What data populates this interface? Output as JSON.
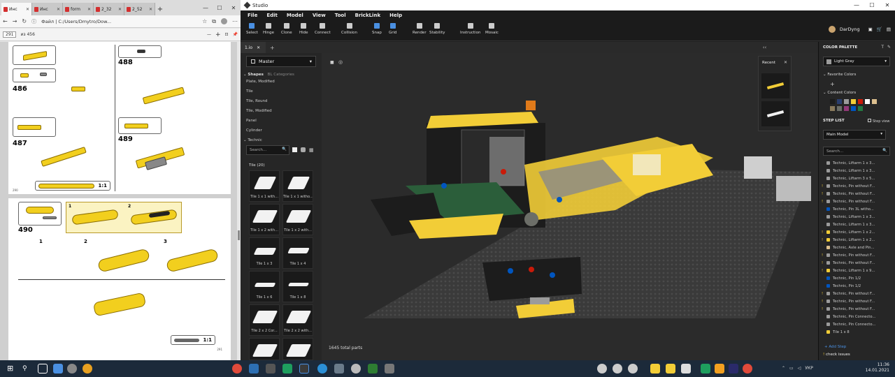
{
  "browser": {
    "tabs": [
      {
        "label": "Инс",
        "active": true
      },
      {
        "label": "Инс",
        "active": false
      },
      {
        "label": "form",
        "active": false
      },
      {
        "label": "2_32",
        "active": false
      },
      {
        "label": "2_52",
        "active": false
      }
    ],
    "address_prefix": "Файл",
    "address": "C:/Users/Dmytro/Dow...",
    "page_current": "291",
    "page_total": "из 456",
    "zoom_minus": "—",
    "zoom_plus": "+",
    "page_a": {
      "steps": [
        "486",
        "487",
        "488",
        "489"
      ],
      "scale_label": "1:1",
      "page_num": "290"
    },
    "page_b": {
      "steps": [
        "490",
        "1",
        "2",
        "3"
      ],
      "callout_subs": [
        "1",
        "2"
      ],
      "scale_label": "1:1",
      "page_num": "291"
    }
  },
  "studio": {
    "title": "Studio",
    "menu": [
      "File",
      "Edit",
      "Model",
      "View",
      "Tool",
      "BrickLink",
      "Help"
    ],
    "tools": [
      {
        "label": "Select",
        "icon": "select-icon"
      },
      {
        "label": "Hinge",
        "icon": "hinge-icon"
      },
      {
        "label": "Clone",
        "icon": "clone-icon"
      },
      {
        "label": "Hide",
        "icon": "hide-icon"
      },
      {
        "label": "Connect",
        "icon": "connect-icon"
      },
      {
        "label": "Collision",
        "icon": "collision-icon"
      },
      {
        "label": "Snap",
        "icon": "snap-icon"
      },
      {
        "label": "Grid",
        "icon": "grid-icon"
      },
      {
        "label": "Render",
        "icon": "render-icon"
      },
      {
        "label": "Stability",
        "icon": "stability-icon"
      },
      {
        "label": "Instruction",
        "icon": "instruction-icon"
      },
      {
        "label": "Mosaic",
        "icon": "mosaic-icon"
      }
    ],
    "user": "DarDyng",
    "doc_tab": "1.io",
    "left_panel": {
      "model": "Master",
      "shapes_tab": "Shapes",
      "bl_tab": "BL Categories",
      "categories": [
        "Plate, Modified",
        "Tile",
        "Tile, Round",
        "Tile, Modified",
        "Panel",
        "Cylinder",
        "Technic"
      ],
      "search_placeholder": "Search...",
      "tile_header": "Tile (20)",
      "parts": [
        "Tile 1 x 1 with...",
        "Tile 1 x 1 witho...",
        "Tile 1 x 2 with...",
        "Tile 1 x 2 with...",
        "Tile 1 x 3",
        "Tile 1 x 4",
        "Tile 1 x 6",
        "Tile 1 x 8",
        "Tile 2 x 2 Cor...",
        "Tile 2 x 2 with...",
        "",
        ""
      ]
    },
    "viewport": {
      "recent_label": "Recent",
      "total_parts": "1645 total parts"
    },
    "right_panel": {
      "color_palette": "COLOR PALETTE",
      "color_selected": "Light Gray",
      "favorite_colors": "Favorite Colors",
      "content_colors": "Content Colors",
      "swatches": [
        "#1c1c1c",
        "#2a3e6e",
        "#9b9b9b",
        "#f2cd37",
        "#c91a09",
        "#ffffff",
        "#dcbf8e",
        "#8a7a5c",
        "#6c6e68",
        "#923978",
        "#0055bf",
        "#237841"
      ],
      "step_list": "STEP LIST",
      "step_view": "Step view",
      "main_model": "Main Model",
      "search_placeholder": "Search...",
      "steps": [
        {
          "label": "Technic, Liftarm 1 x 3...",
          "color": "#9b9b9b",
          "warn": false
        },
        {
          "label": "Technic, Liftarm 1 x 3...",
          "color": "#9b9b9b",
          "warn": false
        },
        {
          "label": "Technic, Liftarm 3 x 5...",
          "color": "#9b9b9b",
          "warn": false
        },
        {
          "label": "Technic, Pin without F...",
          "color": "#9b9b9b",
          "warn": true
        },
        {
          "label": "Technic, Pin without F...",
          "color": "#9b9b9b",
          "warn": true
        },
        {
          "label": "Technic, Pin without F...",
          "color": "#9b9b9b",
          "warn": true
        },
        {
          "label": "Technic, Pin 3L witho...",
          "color": "#0055bf",
          "warn": false
        },
        {
          "label": "Technic, Liftarm 1 x 3...",
          "color": "#9b9b9b",
          "warn": false
        },
        {
          "label": "Technic, Liftarm 1 x 3...",
          "color": "#9b9b9b",
          "warn": false
        },
        {
          "label": "Technic, Liftarm 1 x 2...",
          "color": "#f2cd37",
          "warn": true
        },
        {
          "label": "Technic, Liftarm 1 x 2...",
          "color": "#f2cd37",
          "warn": true
        },
        {
          "label": "Technic, Axle and Pin...",
          "color": "#dcbf8e",
          "warn": false
        },
        {
          "label": "Technic, Pin without F...",
          "color": "#9b9b9b",
          "warn": true
        },
        {
          "label": "Technic, Pin without F...",
          "color": "#9b9b9b",
          "warn": true
        },
        {
          "label": "Technic, Liftarm 1 x 9...",
          "color": "#f2cd37",
          "warn": true
        },
        {
          "label": "Technic, Pin 1/2",
          "color": "#0055bf",
          "warn": false
        },
        {
          "label": "Technic, Pin 1/2",
          "color": "#0055bf",
          "warn": false
        },
        {
          "label": "Technic, Pin without F...",
          "color": "#9b9b9b",
          "warn": true
        },
        {
          "label": "Technic, Pin without F...",
          "color": "#9b9b9b",
          "warn": true
        },
        {
          "label": "Technic, Pin without F...",
          "color": "#9b9b9b",
          "warn": true
        },
        {
          "label": "Technic, Pin Connecto...",
          "color": "#9b9b9b",
          "warn": false
        },
        {
          "label": "Technic, Pin Connecto...",
          "color": "#9b9b9b",
          "warn": false
        },
        {
          "label": "Tile 1 x 8",
          "color": "#f2cd37",
          "warn": false
        }
      ],
      "add_step": "+ Add Step",
      "check_issues": "check issues"
    }
  },
  "taskbar": {
    "lang": "УКР",
    "time": "11:36",
    "date": "14.01.2021"
  }
}
